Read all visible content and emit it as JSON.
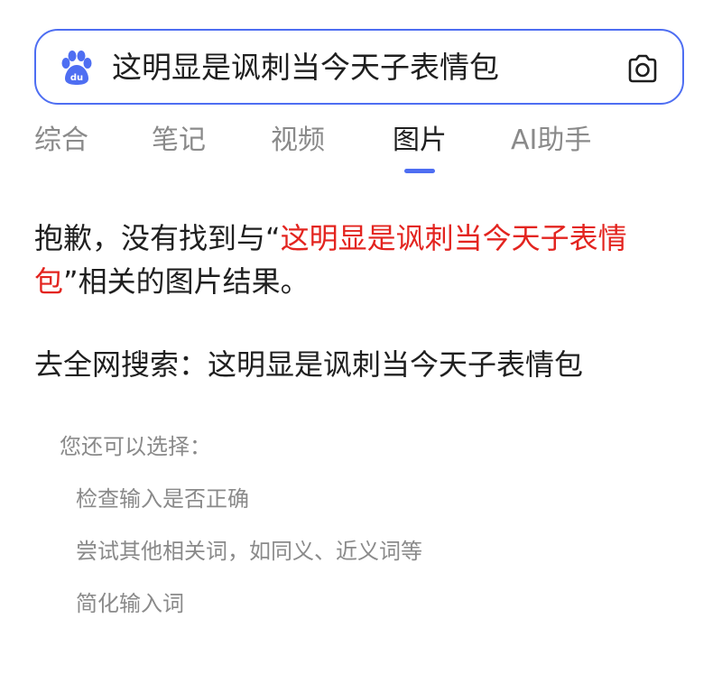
{
  "search": {
    "query": "这明显是讽刺当今天子表情包"
  },
  "tabs": [
    {
      "label": "综合",
      "active": false
    },
    {
      "label": "笔记",
      "active": false
    },
    {
      "label": "视频",
      "active": false
    },
    {
      "label": "图片",
      "active": true
    },
    {
      "label": "AI助手",
      "active": false
    }
  ],
  "icons": {
    "logo": "baidu-paw-logo",
    "camera": "camera-icon"
  },
  "colors": {
    "accent": "#4e6ef2",
    "highlight": "#e3241f",
    "muted": "#8a8a8a"
  },
  "result": {
    "prefix": "抱歉，没有找到与“",
    "highlight": "这明显是讽刺当今天子表情包",
    "suffix": "”相关的图片结果。",
    "full_web_search": "去全网搜索：这明显是讽刺当今天子表情包"
  },
  "suggestions": {
    "title": "您还可以选择：",
    "items": [
      "检查输入是否正确",
      "尝试其他相关词，如同义、近义词等",
      "简化输入词"
    ]
  }
}
